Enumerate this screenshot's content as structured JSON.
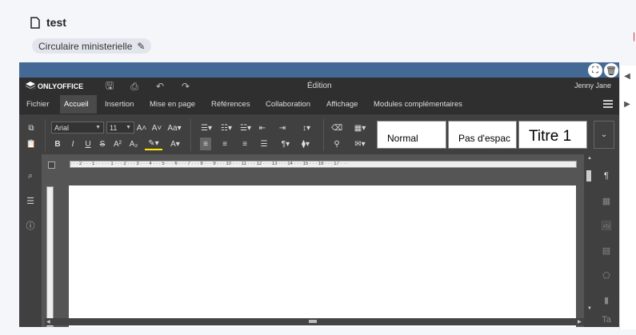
{
  "header": {
    "title": "test",
    "tag": "Circulaire ministerielle"
  },
  "editor": {
    "app_name": "ONLYOFFICE",
    "doc_title": "Édition",
    "user": "Jenny Jane",
    "tabs": [
      "Fichier",
      "Accueil",
      "Insertion",
      "Mise en page",
      "Références",
      "Collaboration",
      "Affichage",
      "Modules complémentaires"
    ],
    "active_tab": "Accueil",
    "font_name": "Arial",
    "font_size": "11",
    "styles": [
      "Normal",
      "Pas d'espac",
      "Titre 1"
    ],
    "ruler": "· · · 2 · · · 1 · · · · · 1 · · · 2 · · · 3 · · · 4 · · · 5 · · · 6 · · · 7 · · · 8 · · · 9 · · · 10 · · · 11 · · · 12 · · · 13 · · · 14 · · · 15 · · · 16 · · · 17 · · ·"
  },
  "colors": {
    "accent": "#446995",
    "dark": "#2f2f2f",
    "toolbar": "#404040"
  }
}
